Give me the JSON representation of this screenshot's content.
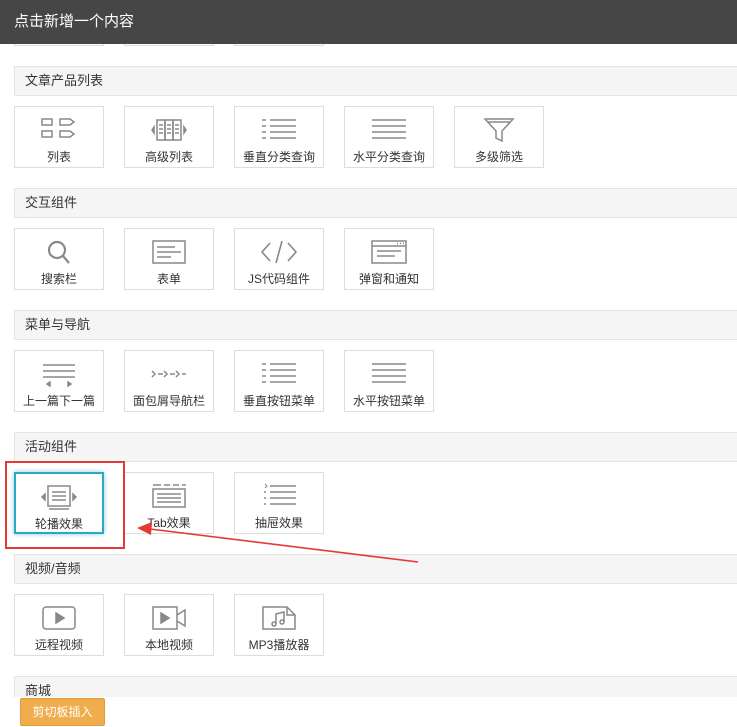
{
  "dialog": {
    "title": "点击新增一个内容"
  },
  "sections": [
    {
      "title": "文章产品列表",
      "items": [
        {
          "label": "列表",
          "icon": "list-icon"
        },
        {
          "label": "高级列表",
          "icon": "advanced-list-icon"
        },
        {
          "label": "垂直分类查询",
          "icon": "vertical-category-icon"
        },
        {
          "label": "水平分类查询",
          "icon": "horizontal-category-icon"
        },
        {
          "label": "多级筛选",
          "icon": "filter-icon"
        }
      ]
    },
    {
      "title": "交互组件",
      "items": [
        {
          "label": "搜索栏",
          "icon": "search-icon"
        },
        {
          "label": "表单",
          "icon": "form-icon"
        },
        {
          "label": "JS代码组件",
          "icon": "code-icon"
        },
        {
          "label": "弹窗和通知",
          "icon": "popup-icon"
        }
      ]
    },
    {
      "title": "菜单与导航",
      "items": [
        {
          "label": "上一篇下一篇",
          "icon": "prev-next-icon"
        },
        {
          "label": "面包屑导航栏",
          "icon": "breadcrumb-icon"
        },
        {
          "label": "垂直按钮菜单",
          "icon": "vertical-menu-icon"
        },
        {
          "label": "水平按钮菜单",
          "icon": "horizontal-menu-icon"
        }
      ]
    },
    {
      "title": "活动组件",
      "items": [
        {
          "label": "轮播效果",
          "icon": "carousel-icon",
          "selected": true
        },
        {
          "label": "Tab效果",
          "icon": "tab-icon"
        },
        {
          "label": "抽屉效果",
          "icon": "drawer-icon"
        }
      ]
    },
    {
      "title": "视频/音频",
      "items": [
        {
          "label": "远程视频",
          "icon": "remote-video-icon"
        },
        {
          "label": "本地视频",
          "icon": "local-video-icon"
        },
        {
          "label": "MP3播放器",
          "icon": "mp3-player-icon"
        }
      ]
    },
    {
      "title": "商城",
      "items": []
    }
  ],
  "footer": {
    "paste_button": "剪切板插入"
  },
  "colors": {
    "titlebar": "#464646",
    "icon_stroke": "#888888",
    "selected_border": "#2aa8c4",
    "annotation_red": "#e53935",
    "paste_button": "#f0ad4e"
  }
}
